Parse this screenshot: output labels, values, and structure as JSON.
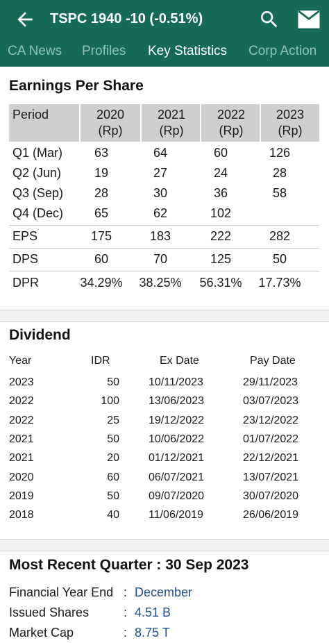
{
  "header": {
    "title": "TSPC  1940 -10 (-0.51%)",
    "accent": "#166b57",
    "icons": [
      "arrow-back-icon",
      "search-icon",
      "mail-icon"
    ]
  },
  "tabs": [
    {
      "label": "CA News",
      "active": false
    },
    {
      "label": "Profiles",
      "active": false
    },
    {
      "label": "Key Statistics",
      "active": true
    },
    {
      "label": "Corp Action",
      "active": false
    }
  ],
  "eps": {
    "title": "Earnings Per Share",
    "period_label": "Period",
    "years": [
      {
        "year": "2020",
        "unit": "(Rp)"
      },
      {
        "year": "2021",
        "unit": "(Rp)"
      },
      {
        "year": "2022",
        "unit": "(Rp)"
      },
      {
        "year": "2023",
        "unit": "(Rp)"
      }
    ],
    "rows": [
      {
        "label": "Q1 (Mar)",
        "values": [
          "63",
          "64",
          "60",
          "126"
        ]
      },
      {
        "label": "Q2 (Jun)",
        "values": [
          "19",
          "27",
          "24",
          "28"
        ]
      },
      {
        "label": "Q3 (Sep)",
        "values": [
          "28",
          "30",
          "36",
          "58"
        ]
      },
      {
        "label": "Q4 (Dec)",
        "values": [
          "65",
          "62",
          "102",
          ""
        ]
      },
      {
        "label": "EPS",
        "values": [
          "175",
          "183",
          "222",
          "282"
        ]
      },
      {
        "label": "DPS",
        "values": [
          "60",
          "70",
          "125",
          "50"
        ]
      },
      {
        "label": "DPR",
        "values": [
          "34.29%",
          "38.25%",
          "56.31%",
          "17.73%"
        ]
      }
    ]
  },
  "dividend": {
    "title": "Dividend",
    "headers": {
      "year": "Year",
      "idr": "IDR",
      "ex_date": "Ex Date",
      "pay_date": "Pay Date"
    },
    "rows": [
      {
        "year": "2023",
        "idr": "50",
        "ex_date": "10/11/2023",
        "pay_date": "29/11/2023"
      },
      {
        "year": "2022",
        "idr": "100",
        "ex_date": "13/06/2023",
        "pay_date": "03/07/2023"
      },
      {
        "year": "2022",
        "idr": "25",
        "ex_date": "19/12/2022",
        "pay_date": "23/12/2022"
      },
      {
        "year": "2021",
        "idr": "50",
        "ex_date": "10/06/2022",
        "pay_date": "01/07/2022"
      },
      {
        "year": "2021",
        "idr": "20",
        "ex_date": "01/12/2021",
        "pay_date": "22/12/2021"
      },
      {
        "year": "2020",
        "idr": "60",
        "ex_date": "06/07/2021",
        "pay_date": "13/07/2021"
      },
      {
        "year": "2019",
        "idr": "50",
        "ex_date": "09/07/2020",
        "pay_date": "30/07/2020"
      },
      {
        "year": "2018",
        "idr": "40",
        "ex_date": "11/06/2019",
        "pay_date": "26/06/2019"
      }
    ]
  },
  "recent": {
    "title": "Most Recent Quarter : 30 Sep 2023",
    "items": [
      {
        "key": "Financial Year End",
        "value": "December"
      },
      {
        "key": "Issued Shares",
        "value": "4.51 B"
      },
      {
        "key": "Market Cap",
        "value": "8.75 T"
      }
    ]
  }
}
